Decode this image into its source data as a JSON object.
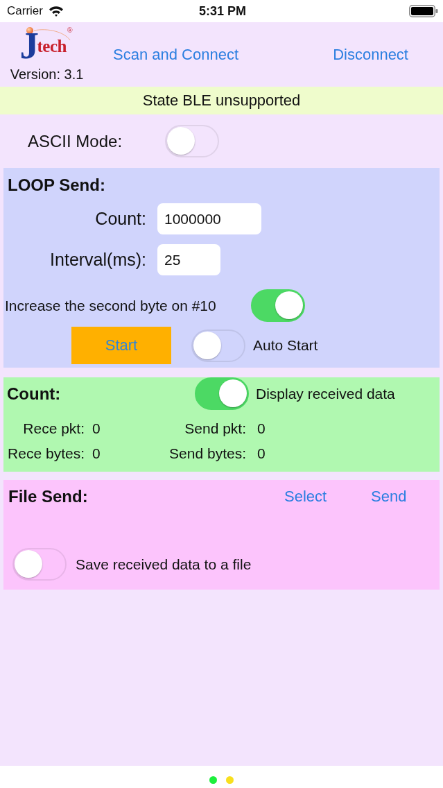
{
  "status_bar": {
    "carrier": "Carrier",
    "time": "5:31 PM"
  },
  "header": {
    "logo": {
      "initial": "J",
      "name": "tech",
      "mark": "®"
    },
    "version": "Version: 3.1",
    "scan_button": "Scan and Connect",
    "disconnect_button": "Disconnect"
  },
  "state_bar": {
    "text": "State BLE unsupported"
  },
  "ascii_mode": {
    "label": "ASCII Mode:",
    "on": false
  },
  "loop_send": {
    "title": "LOOP Send:",
    "fields": [
      {
        "label": "Count:",
        "value": "1000000"
      },
      {
        "label": "Interval(ms):",
        "value": "25"
      }
    ],
    "increase_toggle": {
      "label": "Increase the second byte on #10",
      "on": true
    },
    "start_button": "Start",
    "auto_start": {
      "label": "Auto Start",
      "on": false
    }
  },
  "counters": {
    "title": "Count:",
    "display_toggle": {
      "label": "Display received data",
      "on": true
    },
    "stats": [
      {
        "label": "Rece pkt:",
        "value": "0"
      },
      {
        "label": "Send pkt:",
        "value": "0"
      },
      {
        "label": "Rece bytes:",
        "value": "0"
      },
      {
        "label": "Send bytes:",
        "value": "0"
      }
    ]
  },
  "file_send": {
    "title": "File Send:",
    "select_button": "Select",
    "send_button": "Send",
    "save_toggle": {
      "label": "Save received data to a file",
      "on": false
    }
  },
  "page_dots": [
    {
      "color": "#1cef3c"
    },
    {
      "color": "#f8df1e"
    }
  ]
}
